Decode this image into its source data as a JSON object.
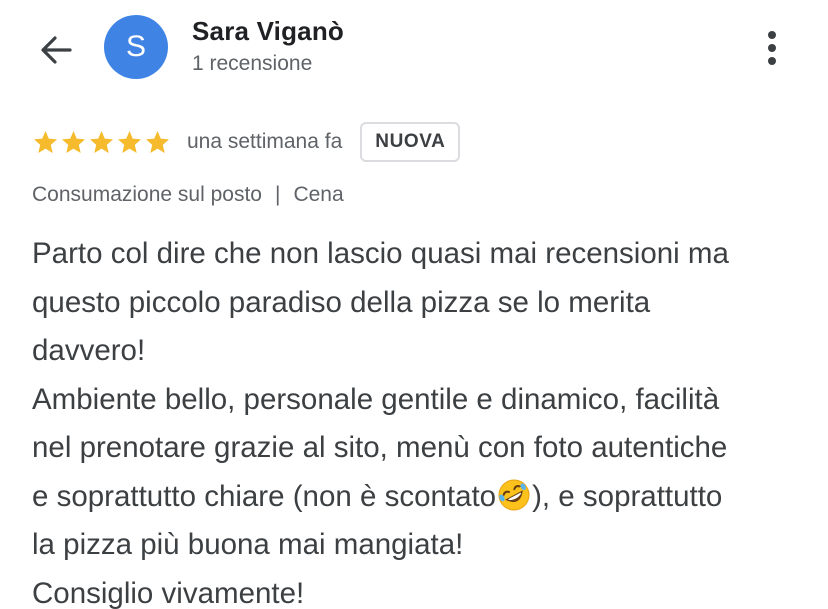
{
  "header": {
    "user_name": "Sara Viganò",
    "review_count": "1 recensione",
    "avatar_letter": "S",
    "avatar_color": "#3f84e5",
    "back_icon": "arrow-left-icon",
    "more_icon": "more-vert-icon"
  },
  "review": {
    "rating": 5,
    "rating_max": 5,
    "star_color": "#f5bb2c",
    "time": "una settimana fa",
    "badge": "NUOVA",
    "service_type": "Consumazione sul posto",
    "separator": "|",
    "meal_type": "Cena",
    "text_lines": [
      "Parto col dire che non lascio quasi mai recensioni ma",
      "questo piccolo paradiso della pizza se lo merita",
      "davvero!",
      "Ambiente bello, personale gentile e dinamico, facilità",
      "nel prenotare grazie al sito, menù con foto autentiche",
      "e soprattutto chiare (non è scontato",
      "), e soprattutto",
      "la pizza più buona mai mangiata!",
      "Consiglio vivamente!"
    ],
    "emoji": "rolling-on-floor-laughing-emoji"
  }
}
